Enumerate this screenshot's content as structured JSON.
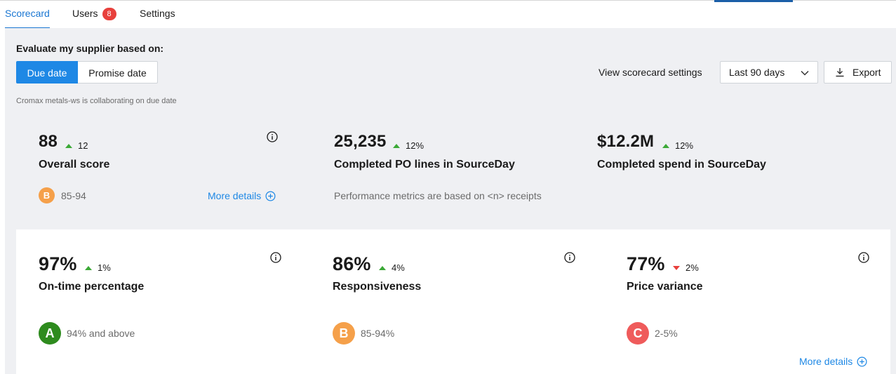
{
  "tabs": [
    {
      "label": "Scorecard",
      "active": true
    },
    {
      "label": "Users",
      "badge": "8"
    },
    {
      "label": "Settings"
    }
  ],
  "evaluate": {
    "label": "Evaluate my supplier based on:",
    "options": [
      "Due date",
      "Promise date"
    ],
    "selected": "Due date",
    "note": "Cromax metals-ws is collaborating on due date"
  },
  "toolbar": {
    "settings_link": "View scorecard settings",
    "range_value": "Last 90 days",
    "export_label": "Export"
  },
  "summary": {
    "overall": {
      "value": "88",
      "delta": "12",
      "direction": "up",
      "label": "Overall score",
      "grade": "B",
      "range": "85-94",
      "more": "More details"
    },
    "po_lines": {
      "value": "25,235",
      "delta": "12%",
      "direction": "up",
      "label": "Completed PO lines in SourceDay",
      "note": "Performance metrics are based on <n> receipts"
    },
    "spend": {
      "value": "$12.2M",
      "delta": "12%",
      "direction": "up",
      "label": "Completed spend in SourceDay"
    }
  },
  "metrics": [
    {
      "value": "97%",
      "delta": "1%",
      "direction": "up",
      "label": "On-time percentage",
      "grade": "A",
      "range": "94% and above"
    },
    {
      "value": "86%",
      "delta": "4%",
      "direction": "up",
      "label": "Responsiveness",
      "grade": "B",
      "range": "85-94%"
    },
    {
      "value": "77%",
      "delta": "2%",
      "direction": "down",
      "label": "Price variance",
      "grade": "C",
      "range": "2-5%"
    }
  ],
  "metrics_more": "More details",
  "icons": [
    "info-icon",
    "plus-circle-icon",
    "chevron-down-icon",
    "download-icon",
    "triangle-up-icon",
    "triangle-down-icon"
  ],
  "colors": {
    "accent": "#1e88e5",
    "up": "#3ba936",
    "down": "#e8403c",
    "grade_a": "#2e8b1e",
    "grade_b": "#f5a04a",
    "grade_c": "#ef5b5b",
    "panel": "#eff0f3"
  }
}
